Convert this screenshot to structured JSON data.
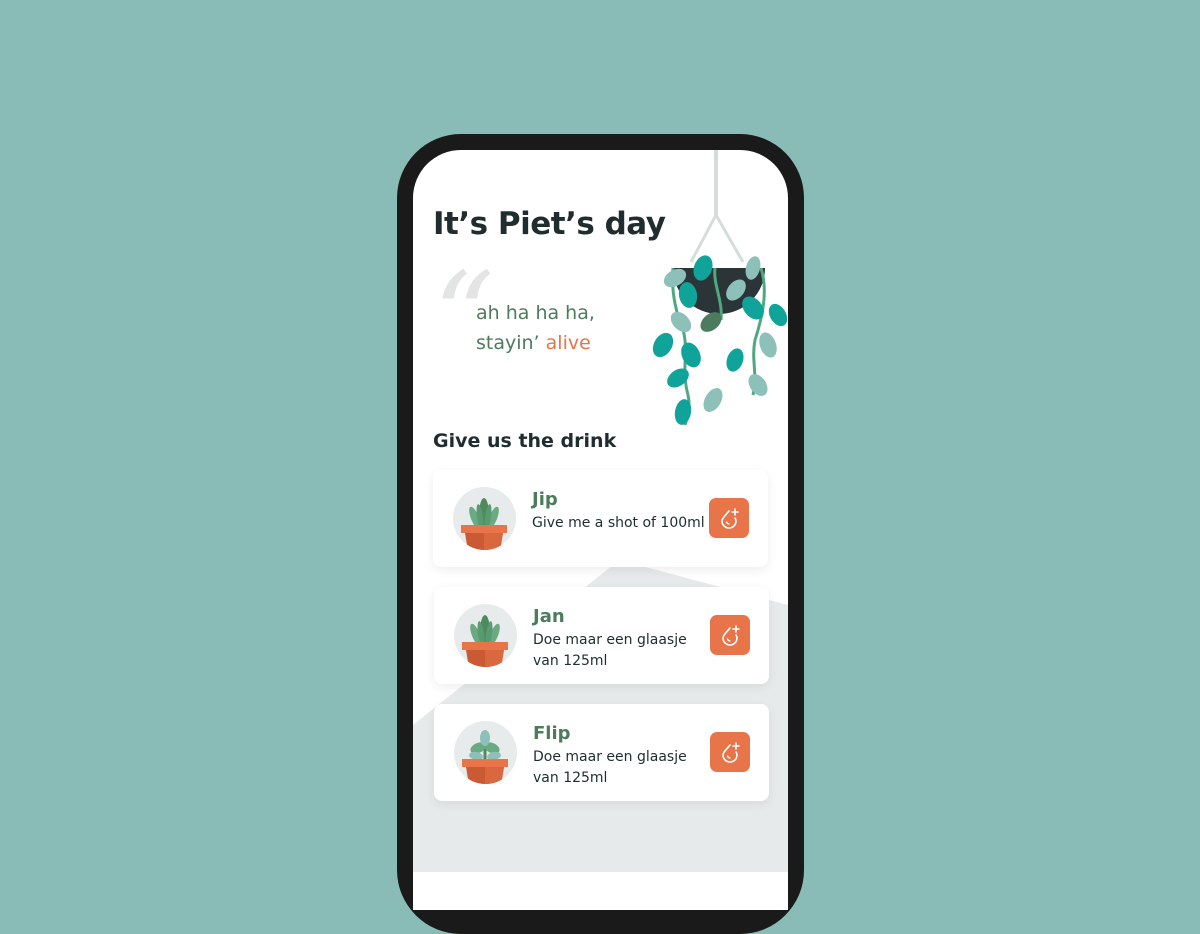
{
  "screen": {
    "title": "It’s Piet’s day",
    "quote": {
      "mark": "“",
      "line1": "ah ha ha ha,",
      "line2_prefix": "stayin’",
      "line2_accent": "alive"
    },
    "section_title": "Give us the drink"
  },
  "plants": [
    {
      "name": "Jip",
      "description": "Give me a shot of 100ml",
      "avatar_icon": "potted-succulent-icon",
      "action_icon": "water-drop-plus-icon"
    },
    {
      "name": "Jan",
      "description": "Doe maar een glaasje van 125ml",
      "avatar_icon": "potted-succulent-icon",
      "action_icon": "water-drop-plus-icon"
    },
    {
      "name": "Flip",
      "description": "Doe maar een glaasje van 125ml",
      "avatar_icon": "potted-sprout-icon",
      "action_icon": "water-drop-plus-icon"
    }
  ],
  "colors": {
    "background": "#8abcb7",
    "heading": "#1f2d2e",
    "green": "#4d7b5e",
    "accent": "#e8744a",
    "leaf": "#0fa39a"
  }
}
